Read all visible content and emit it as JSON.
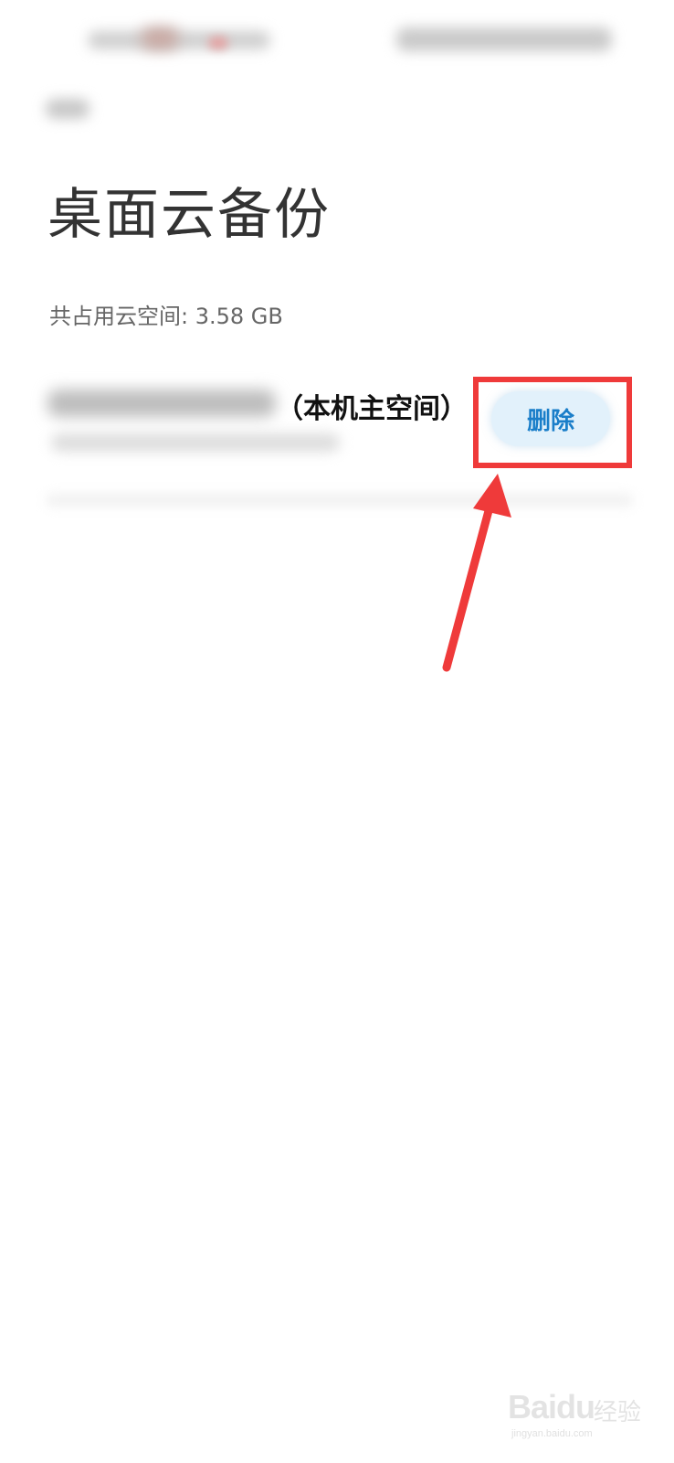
{
  "page": {
    "title": "桌面云备份",
    "usage_text": "共占用云空间: 3.58 GB"
  },
  "backup_item": {
    "device_tag": "（本机主空间）",
    "delete_label": "删除"
  },
  "annotation": {
    "color": "#ef3a3a"
  },
  "watermark": {
    "logo": "Baidu",
    "jingyan": "经验",
    "url": "jingyan.baidu.com"
  },
  "colors": {
    "accent": "#1a7ec9",
    "button_bg": "#e2f1fb"
  },
  "icons": {
    "back": "back-arrow-icon"
  }
}
